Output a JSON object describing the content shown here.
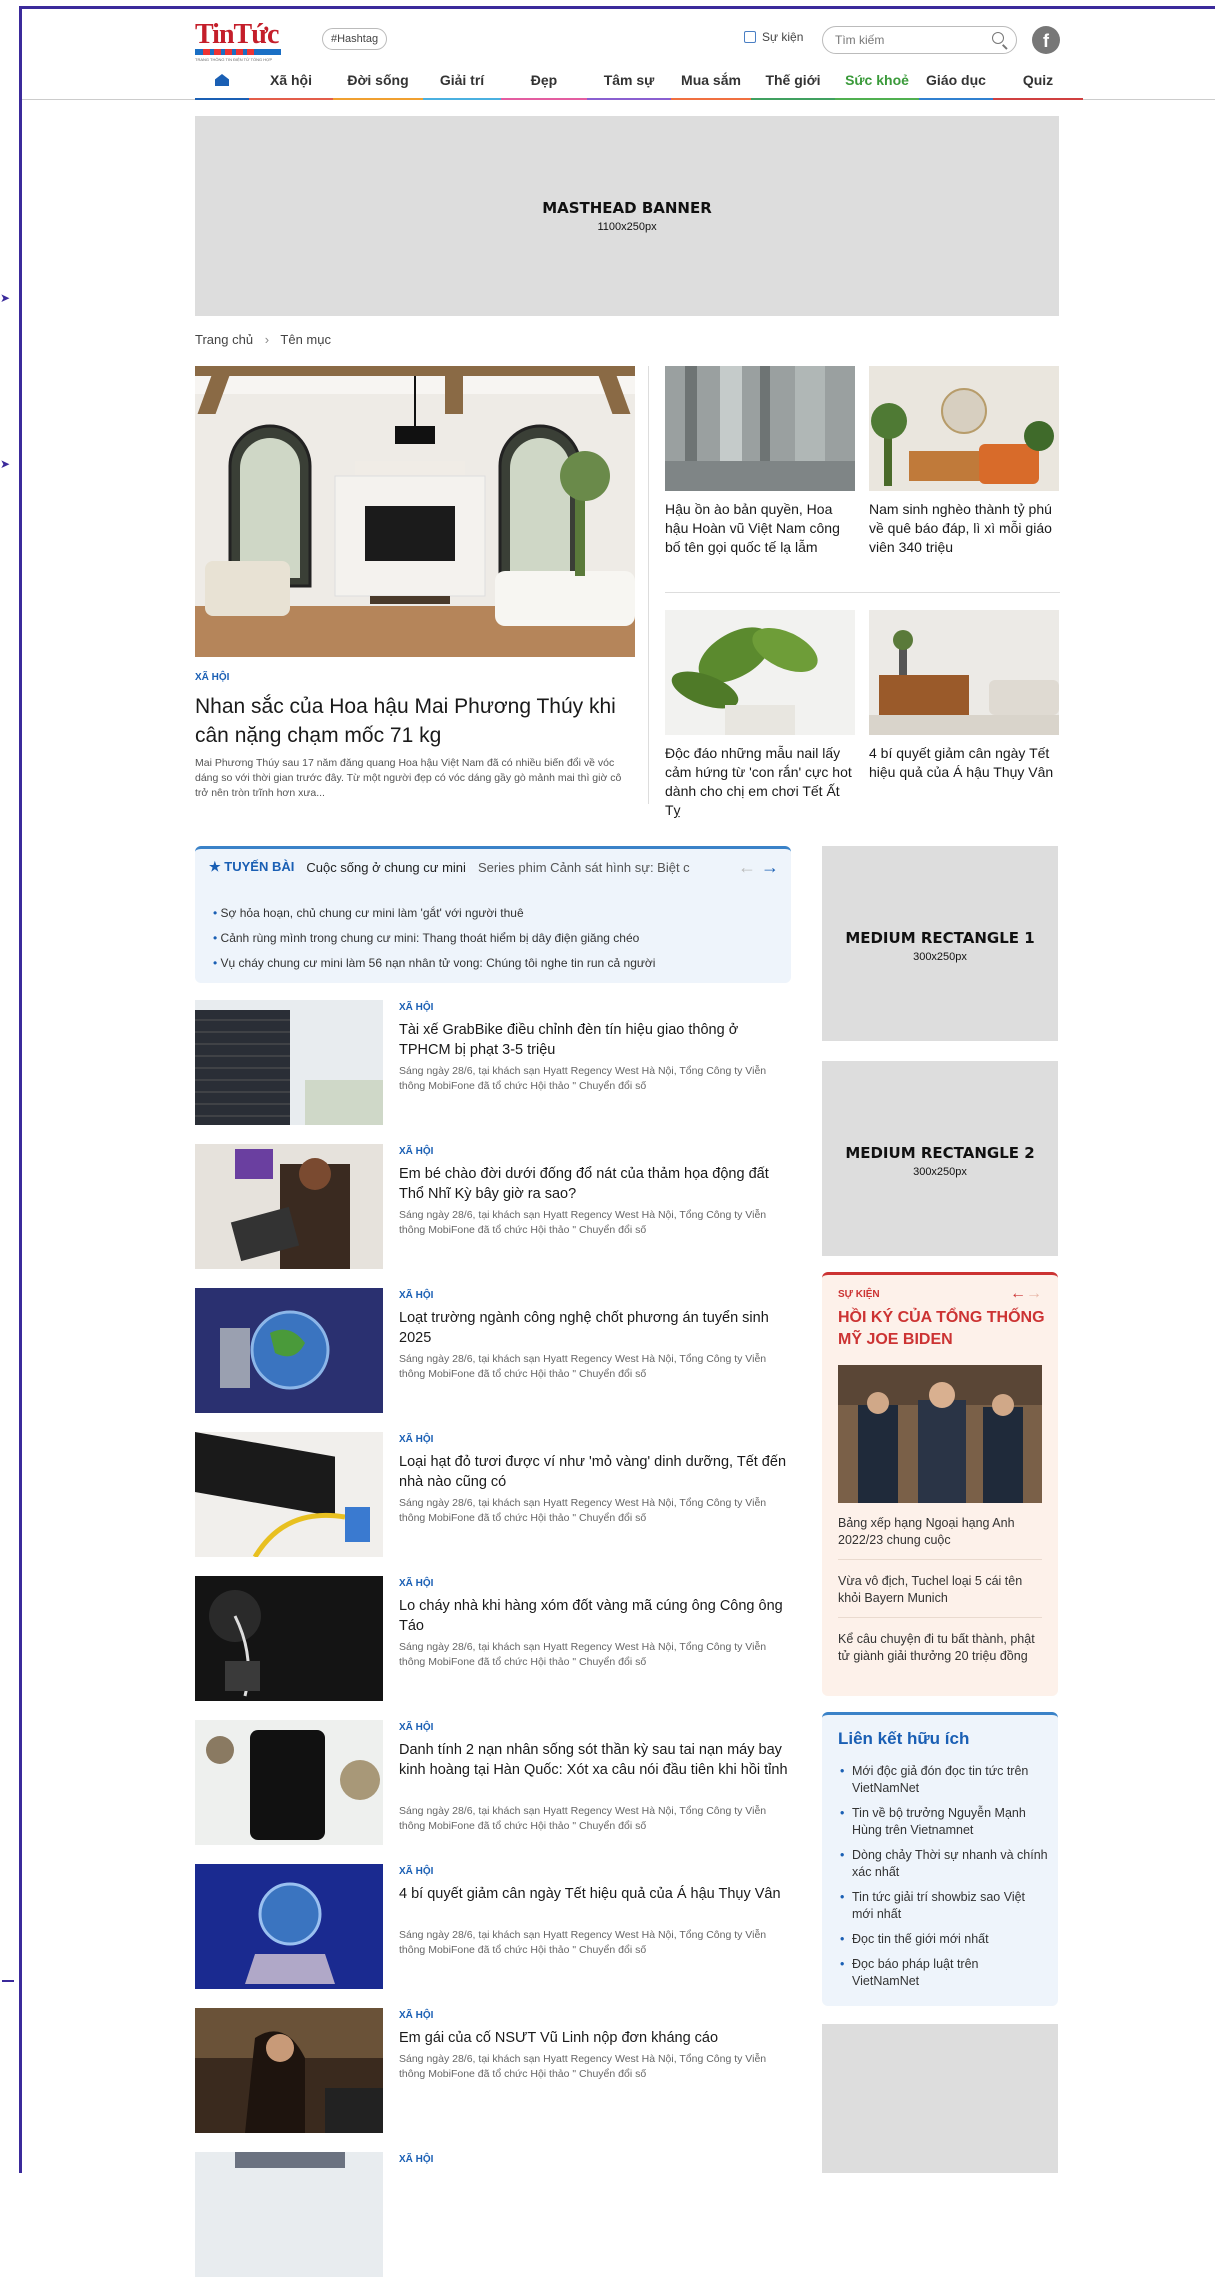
{
  "logo": {
    "text": "TinTức",
    "sub": "TRANG THÔNG TIN ĐIỆN TỬ TỔNG HỢP"
  },
  "header": {
    "hashtag": "#Hashtag",
    "event_link": "Sự kiện",
    "search_placeholder": "Tìm kiếm",
    "facebook": "f"
  },
  "nav": [
    {
      "label": "Xã hội",
      "color": "#e35d4a"
    },
    {
      "label": "Đời sống",
      "color": "#f0a030"
    },
    {
      "label": "Giải trí",
      "color": "#4ab0e0"
    },
    {
      "label": "Đẹp",
      "color": "#e35da0"
    },
    {
      "label": "Tâm sự",
      "color": "#8a5fd0"
    },
    {
      "label": "Mua sắm",
      "color": "#f07040"
    },
    {
      "label": "Thế giới",
      "color": "#40a060"
    },
    {
      "label": "Sức khoẻ",
      "color": "#50b050"
    },
    {
      "label": "Giáo dục",
      "color": "#3080d0"
    },
    {
      "label": "Quiz",
      "color": "#d04040"
    }
  ],
  "masthead": {
    "title": "MASTHEAD BANNER",
    "size": "1100x250px"
  },
  "breadcrumb": {
    "home": "Trang chủ",
    "sep": "›",
    "current": "Tên mục"
  },
  "lead": {
    "category": "XÃ HỘI",
    "title": "Nhan sắc của Hoa hậu Mai Phương Thúy khi cân nặng chạm mốc 71 kg",
    "summary": "Mai Phương Thúy sau 17 năm đăng quang Hoa hậu Việt Nam đã có nhiều biến đổi về vóc dáng so với thời gian trước đây. Từ một người đẹp có vóc dáng gầy gò mảnh mai thì giờ cô trở nên tròn trĩnh hơn xưa..."
  },
  "featured": [
    "Hậu ồn ào bản quyền, Hoa hậu Hoàn vũ Việt Nam công bố tên gọi quốc tế lạ lẫm",
    "Nam sinh nghèo thành tỷ phú về quê báo đáp, lì xì mỗi giáo viên 340 triệu",
    "Độc đáo những mẫu nail lấy cảm hứng từ 'con rắn' cực hot dành cho chị em chơi Tết Ất Tỵ",
    "4 bí quyết giảm cân ngày Tết hiệu quả của Á hậu Thụy Vân"
  ],
  "series": {
    "label": "TUYẾN BÀI",
    "active": "Cuộc sống ở chung cư mini",
    "other": "Series phim Cảnh sát hình sự: Biệt c",
    "prev": "←",
    "next": "→",
    "items": [
      "Sợ hỏa hoạn, chủ chung cư mini làm 'gắt' với người thuê",
      "Cảnh rùng mình trong chung cư mini: Thang thoát hiểm bị dây điện giăng chéo",
      "Vụ cháy chung cư mini làm 56 nạn nhân tử vong: Chúng tôi nghe tin run cả người"
    ]
  },
  "articles": [
    {
      "category": "XÃ HỘI",
      "title": "Tài xế GrabBike điều chỉnh đèn tín hiệu giao thông ở TPHCM bị phạt 3-5 triệu",
      "summary": "Sáng ngày 28/6, tại khách sạn Hyatt Regency West Hà Nội, Tổng Công ty Viễn thông MobiFone đã tổ chức Hội thảo \" Chuyển đổi số"
    },
    {
      "category": "XÃ HỘI",
      "title": "Em bé chào đời dưới đống đổ nát của thảm họa động đất Thổ Nhĩ Kỳ bây giờ ra sao?",
      "summary": "Sáng ngày 28/6, tại khách sạn Hyatt Regency West Hà Nội, Tổng Công ty Viễn thông MobiFone đã tổ chức Hội thảo \" Chuyển đổi số"
    },
    {
      "category": "XÃ HỘI",
      "title": "Loạt trường ngành công nghệ chốt phương án tuyển sinh 2025",
      "summary": "Sáng ngày 28/6, tại khách sạn Hyatt Regency West Hà Nội, Tổng Công ty Viễn thông MobiFone đã tổ chức Hội thảo \" Chuyển đổi số"
    },
    {
      "category": "XÃ HỘI",
      "title": "Loại hạt đỏ tươi được ví như 'mỏ vàng' dinh dưỡng, Tết đến nhà nào cũng có",
      "summary": "Sáng ngày 28/6, tại khách sạn Hyatt Regency West Hà Nội, Tổng Công ty Viễn thông MobiFone đã tổ chức Hội thảo \" Chuyển đổi số"
    },
    {
      "category": "XÃ HỘI",
      "title": "Lo cháy nhà khi hàng xóm đốt vàng mã cúng ông Công ông Táo",
      "summary": "Sáng ngày 28/6, tại khách sạn Hyatt Regency West Hà Nội, Tổng Công ty Viễn thông MobiFone đã tổ chức Hội thảo \" Chuyển đổi số"
    },
    {
      "category": "XÃ HỘI",
      "title": "Danh tính 2 nạn nhân sống sót thần kỳ sau tai nạn máy bay kinh hoàng tại Hàn Quốc: Xót xa câu nói đầu tiên khi hồi tỉnh",
      "summary": "Sáng ngày 28/6, tại khách sạn Hyatt Regency West Hà Nội, Tổng Công ty Viễn thông MobiFone đã tổ chức Hội thảo \" Chuyển đổi số"
    },
    {
      "category": "XÃ HỘI",
      "title": "4 bí quyết giảm cân ngày Tết hiệu quả của Á hậu Thụy Vân",
      "summary": "Sáng ngày 28/6, tại khách sạn Hyatt Regency West Hà Nội, Tổng Công ty Viễn thông MobiFone đã tổ chức Hội thảo \" Chuyển đổi số"
    },
    {
      "category": "XÃ HỘI",
      "title": "Em gái của cố NSƯT Vũ Linh nộp đơn kháng cáo",
      "summary": "Sáng ngày 28/6, tại khách sạn Hyatt Regency West Hà Nội, Tổng Công ty Viễn thông MobiFone đã tổ chức Hội thảo \" Chuyển đổi số"
    },
    {
      "category": "XÃ HỘI",
      "title": "",
      "summary": ""
    }
  ],
  "ads": [
    {
      "title": "MEDIUM RECTANGLE 1",
      "size": "300x250px"
    },
    {
      "title": "MEDIUM RECTANGLE 2",
      "size": "300x250px"
    }
  ],
  "event": {
    "kicker": "SỰ KIỆN",
    "title": "HỒI KÝ CỦA TỔNG THỐNG MỸ JOE BIDEN",
    "prev": "←",
    "next": "→",
    "items": [
      "Bảng xếp hạng Ngoại hạng Anh 2022/23 chung cuộc",
      "Vừa vô địch, Tuchel loại 5 cái tên khỏi Bayern Munich",
      "Kể câu chuyện đi tu bất thành, phật tử giành giải thưởng 20 triệu đồng"
    ]
  },
  "links": {
    "title": "Liên kết hữu ích",
    "items": [
      "Mới độc giả đón đọc tin tức trên VietNamNet",
      "Tin về bộ trưởng Nguyễn Mạnh Hùng trên Vietnamnet",
      "Dòng chảy Thời sự nhanh và chính xác nhất",
      "Tin tức giải trí showbiz sao Việt mới nhất",
      "Đọc tin thế giới mới nhất",
      "Đọc báo pháp luật trên VietNamNet"
    ]
  }
}
